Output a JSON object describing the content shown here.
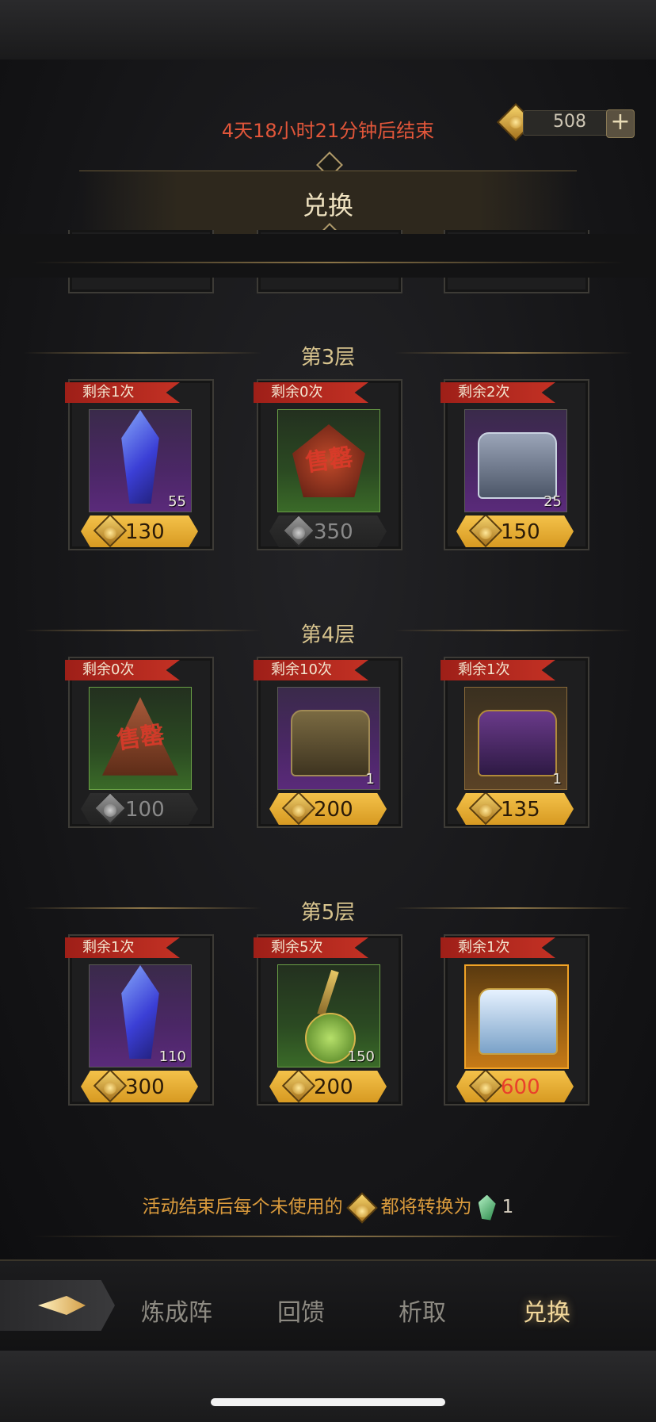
{
  "header": {
    "timer": "4天18小时21分钟后结束",
    "currency_value": "508",
    "plus_label": "+",
    "title": "兑换"
  },
  "floors": [
    {
      "label": "第3层",
      "items": [
        {
          "remaining": "剩余1次",
          "qty": "55",
          "price": "130",
          "price_style": "gold",
          "slot": "purple",
          "icon": "blue-crystal-icon"
        },
        {
          "remaining": "剩余0次",
          "qty": "",
          "price": "350",
          "price_style": "grey",
          "slot": "green",
          "icon": "horned-relic-icon",
          "sold_text": "售罄"
        },
        {
          "remaining": "剩余2次",
          "qty": "25",
          "price": "150",
          "price_style": "gold",
          "slot": "purple",
          "icon": "silver-chest-icon"
        }
      ]
    },
    {
      "label": "第4层",
      "items": [
        {
          "remaining": "剩余0次",
          "qty": "",
          "price": "100",
          "price_style": "grey",
          "slot": "green",
          "icon": "pyramid-relic-icon",
          "sold_text": "售罄"
        },
        {
          "remaining": "剩余10次",
          "qty": "1",
          "price": "200",
          "price_style": "gold",
          "slot": "purple",
          "icon": "gold-chest-icon"
        },
        {
          "remaining": "剩余1次",
          "qty": "1",
          "price": "135",
          "price_style": "gold",
          "slot": "brown",
          "icon": "dark-chest-icon"
        }
      ]
    },
    {
      "label": "第5层",
      "items": [
        {
          "remaining": "剩余1次",
          "qty": "110",
          "price": "300",
          "price_style": "gold",
          "slot": "purple",
          "icon": "blue-crystal-icon"
        },
        {
          "remaining": "剩余5次",
          "qty": "150",
          "price": "200",
          "price_style": "gold",
          "slot": "green",
          "icon": "green-potion-icon"
        },
        {
          "remaining": "剩余1次",
          "qty": "",
          "price": "600",
          "price_style": "gold-red",
          "slot": "orange",
          "icon": "ice-chest-icon"
        }
      ]
    }
  ],
  "note": {
    "before": "活动结束后每个未使用的",
    "after": "都将转换为",
    "amount": "1"
  },
  "tabs": [
    "炼成阵",
    "回馈",
    "析取",
    "兑换"
  ],
  "active_tab": "兑换"
}
